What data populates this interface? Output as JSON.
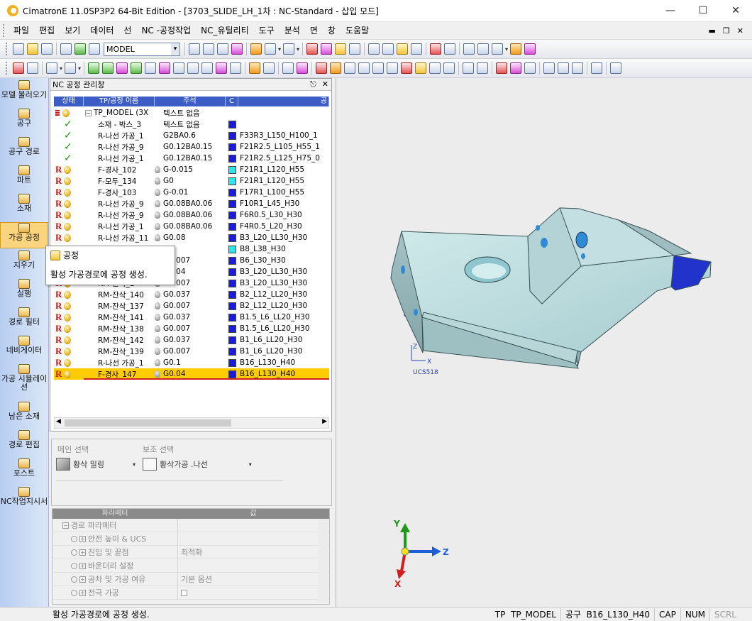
{
  "window": {
    "title": "CimatronE 11.0SP3P2 64-Bit Edition - [3703_SLIDE_LH_1차 : NC-Standard - 삽입 모드]"
  },
  "menu": [
    "파일",
    "편집",
    "보기",
    "데이터",
    "선",
    "NC -공정작업",
    "NC_유틸리티",
    "도구",
    "분석",
    "면",
    "창",
    "도움말"
  ],
  "toolbar": {
    "model_select": "MODEL"
  },
  "sidebar": {
    "items": [
      {
        "label": "모델 불러오기",
        "active": false
      },
      {
        "label": "공구",
        "active": false
      },
      {
        "label": "공구 경로",
        "active": false
      },
      {
        "label": "파트",
        "active": false
      },
      {
        "label": "소재",
        "active": false
      },
      {
        "label": "가공 공정",
        "active": true
      },
      {
        "label": "지우기",
        "active": false
      },
      {
        "label": "실행",
        "active": false
      },
      {
        "label": "경로 필터",
        "active": false
      },
      {
        "label": "네비게이터",
        "active": false
      },
      {
        "label": "가공 시뮬레이션",
        "active": false
      },
      {
        "label": "남은 소재",
        "active": false
      },
      {
        "label": "경로 편집",
        "active": false
      },
      {
        "label": "포스트",
        "active": false
      },
      {
        "label": "NC작업지시서",
        "active": false
      }
    ]
  },
  "nc_panel": {
    "title": "NC 공정 관리창",
    "columns": [
      "상태",
      "TP/공정 이름",
      "주석",
      "C",
      "공"
    ],
    "rows": [
      {
        "status": "root",
        "name": "TP_MODEL (3X",
        "note": "텍스트 없음",
        "color": "",
        "tool": ""
      },
      {
        "status": "ok",
        "name": "소재 - 박스_3",
        "note": "텍스트 없음",
        "color": "#1a1ae0",
        "tool": ""
      },
      {
        "status": "ok",
        "name": "R-나선 가공_1",
        "note": "G2BA0.6",
        "color": "#1a1ae0",
        "tool": "F33R3_L150_H100_1"
      },
      {
        "status": "ok",
        "name": "R-나선 가공_9",
        "note": "G0.12BA0.15",
        "color": "#1a1ae0",
        "tool": "F21R2.5_L105_H55_1"
      },
      {
        "status": "ok",
        "name": "R-나선 가공_1",
        "note": "G0.12BA0.15",
        "color": "#1a1ae0",
        "tool": "F21R2.5_L125_H75_0"
      },
      {
        "status": "R",
        "name": "F-경사_102",
        "note": "G-0.015",
        "color": "#28e6f0",
        "tool": "F21R1_L120_H55"
      },
      {
        "status": "R",
        "name": "F-모두_134",
        "note": "G0",
        "color": "#28e6f0",
        "tool": "F21R1_L120_H55"
      },
      {
        "status": "R",
        "name": "F-경사_103",
        "note": "G-0.01",
        "color": "#1a1ae0",
        "tool": "F17R1_L100_H55"
      },
      {
        "status": "R",
        "name": "R-나선 가공_9",
        "note": "G0.08BA0.06",
        "color": "#1a1ae0",
        "tool": "F10R1_L45_H30"
      },
      {
        "status": "R",
        "name": "R-나선 가공_9",
        "note": "G0.08BA0.06",
        "color": "#1a1ae0",
        "tool": "F6R0.5_L30_H30"
      },
      {
        "status": "R",
        "name": "R-나선 가공_1",
        "note": "G0.08BA0.06",
        "color": "#1a1ae0",
        "tool": "F4R0.5_L20_H30"
      },
      {
        "status": "R",
        "name": "R-나선 가공_11",
        "note": "G0.08",
        "color": "#1a1ae0",
        "tool": "B3_L20_LL30_H30"
      },
      {
        "status": "R",
        "name": "F-경사_10",
        "note": "G0",
        "color": "#28e6f0",
        "tool": "B8_L38_H30"
      },
      {
        "status": "R",
        "name": "RM-잔삭_1",
        "note": "G0.007",
        "color": "#1a1ae0",
        "tool": "B6_L30_H30"
      },
      {
        "status": "R",
        "name": "RM-잔삭_1",
        "note": "G0.04",
        "color": "#1a1ae0",
        "tool": "B3_L20_LL30_H30"
      },
      {
        "status": "R",
        "name": "RM-잔삭_1",
        "note": "G0.007",
        "color": "#1a1ae0",
        "tool": "B3_L20_LL30_H30"
      },
      {
        "status": "R",
        "name": "RM-잔삭_140",
        "note": "G0.037",
        "color": "#1a1ae0",
        "tool": "B2_L12_LL20_H30"
      },
      {
        "status": "R",
        "name": "RM-잔삭_137",
        "note": "G0.007",
        "color": "#1a1ae0",
        "tool": "B2_L12_LL20_H30"
      },
      {
        "status": "R",
        "name": "RM-잔삭_141",
        "note": "G0.037",
        "color": "#1a1ae0",
        "tool": "B1.5_L6_LL20_H30"
      },
      {
        "status": "R",
        "name": "RM-잔삭_138",
        "note": "G0.007",
        "color": "#1a1ae0",
        "tool": "B1.5_L6_LL20_H30"
      },
      {
        "status": "R",
        "name": "RM-잔삭_142",
        "note": "G0.037",
        "color": "#1a1ae0",
        "tool": "B1_L6_LL20_H30"
      },
      {
        "status": "R",
        "name": "RM-잔삭_139",
        "note": "G0.007",
        "color": "#1a1ae0",
        "tool": "B1_L6_LL20_H30"
      },
      {
        "status": "R",
        "name": "R-나선 가공_1",
        "note": "G0.1",
        "color": "#1a1ae0",
        "tool": "B16_L130_H40"
      },
      {
        "status": "R",
        "name": "F-경사_147",
        "note": "G0.04",
        "color": "#1a1ae0",
        "tool": "B16_L130_H40",
        "selected": true
      }
    ]
  },
  "tooltip": {
    "title": "공정",
    "body": "활성  가공경로에 공정 생성."
  },
  "selection": {
    "main_label": "메인 선택",
    "main_value": "황삭 밀링",
    "sub_label": "보조 선택",
    "sub_value": "황삭가공 .나선"
  },
  "params": {
    "columns": [
      "파라메터",
      "값"
    ],
    "rows": [
      {
        "name": "경로 파라메터",
        "value": ""
      },
      {
        "name": "안전 높이 & UCS",
        "value": ""
      },
      {
        "name": "진입 및 끝점",
        "value": "최적화"
      },
      {
        "name": "바운더리 설정",
        "value": ""
      },
      {
        "name": "공차 및 가공 여유",
        "value": "기본 옵션"
      },
      {
        "name": "전극 가공",
        "value": ""
      }
    ]
  },
  "viewport": {
    "ucs_label": "UCS518",
    "axis_y": "Y",
    "axis_z": "Z",
    "axis_x": "X",
    "small_axis_x": "X",
    "small_axis_z": "Z"
  },
  "status": {
    "message": "활성  가공경로에 공정 생성.",
    "tp_label": "TP",
    "tp_value": "TP_MODEL",
    "tool_label": "공구",
    "tool_value": "B16_L130_H40",
    "cap": "CAP",
    "num": "NUM",
    "scrl": "SCRL"
  }
}
